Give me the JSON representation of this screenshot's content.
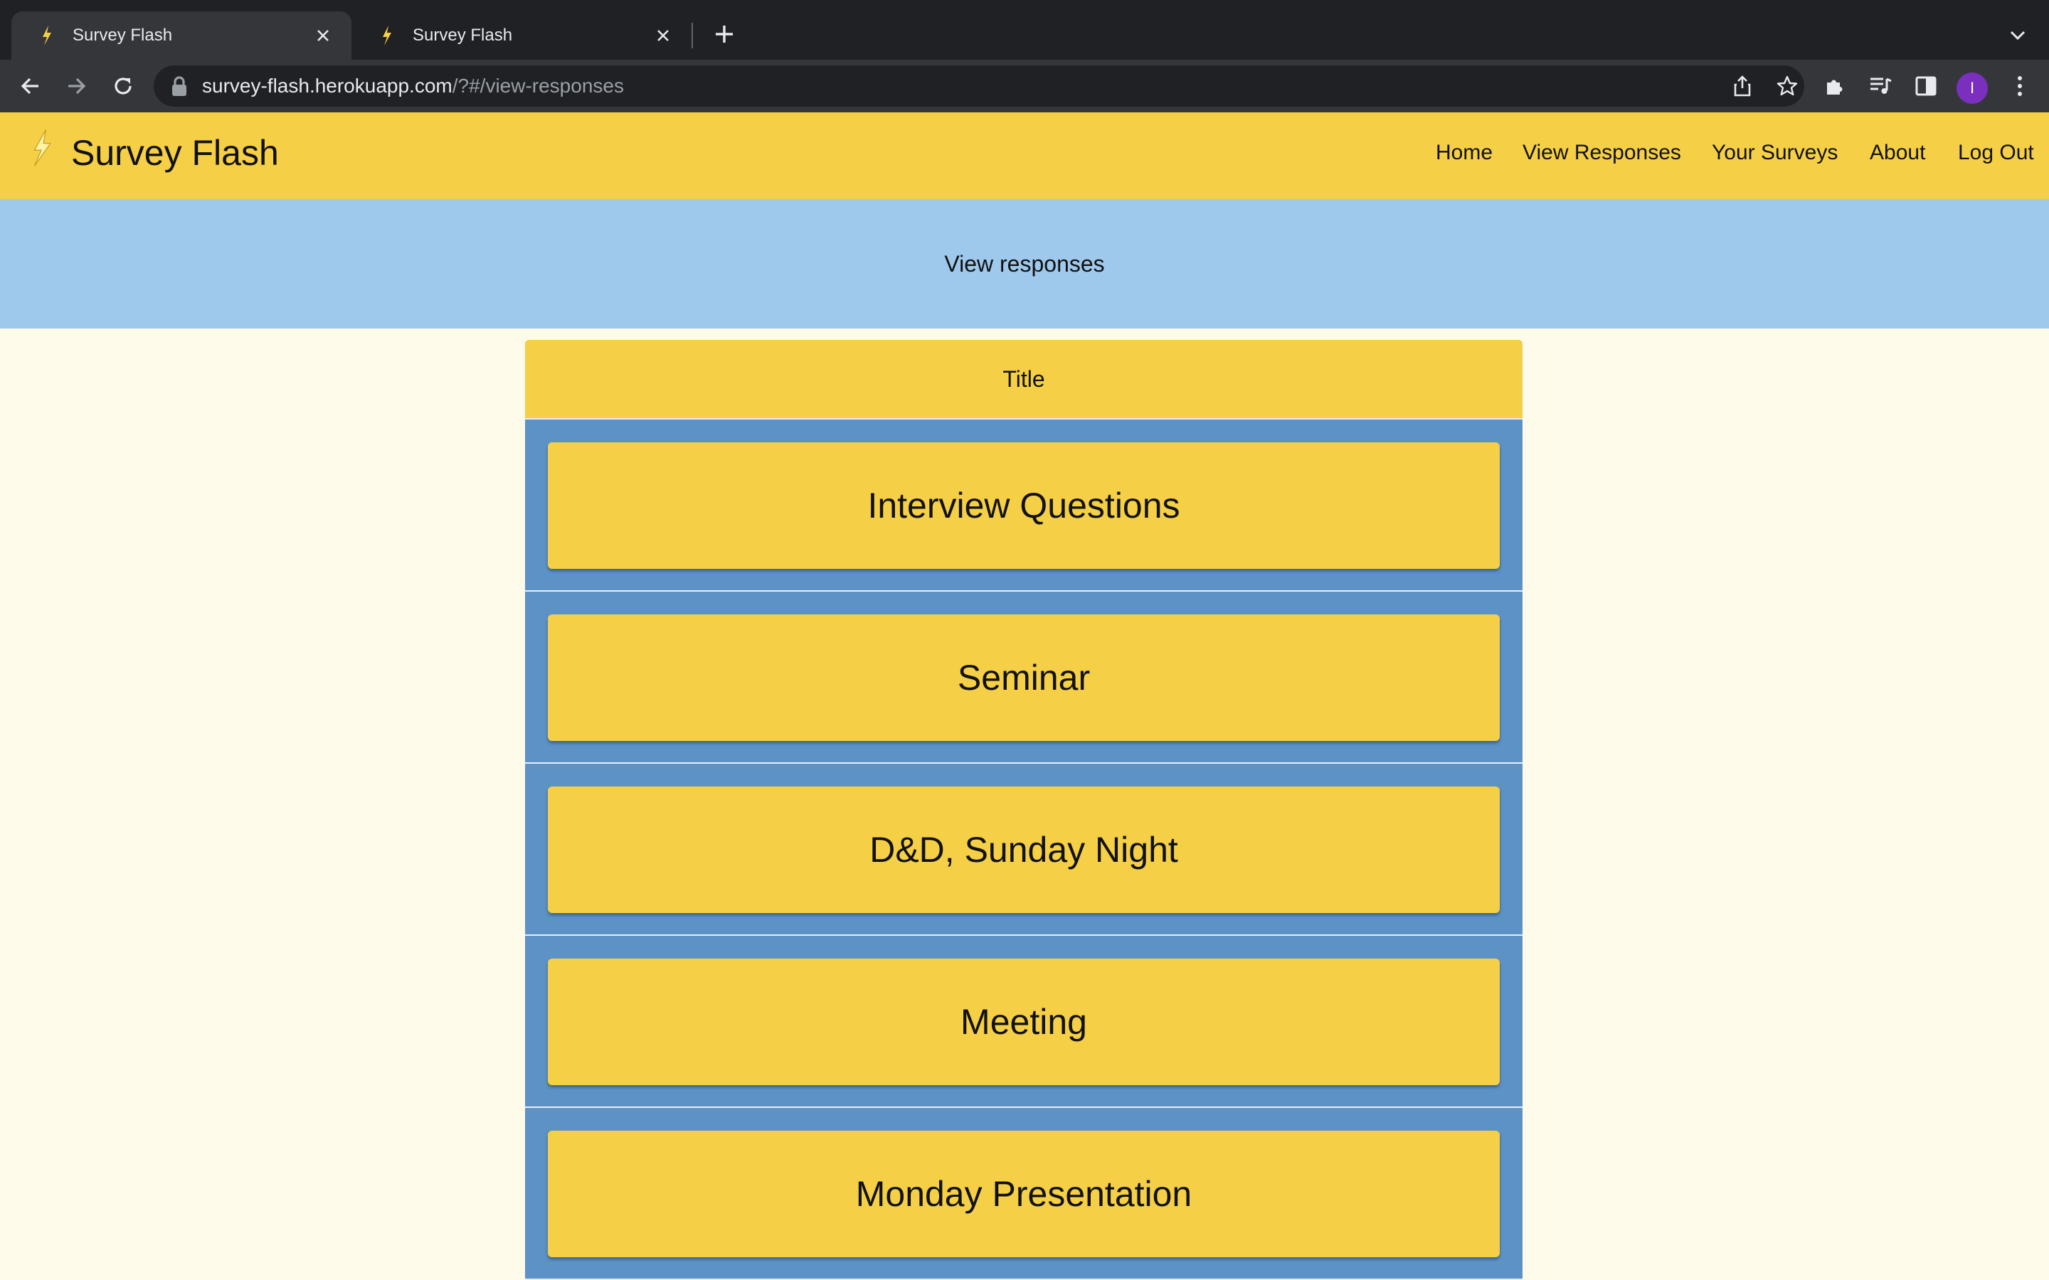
{
  "browser": {
    "tabs": [
      {
        "title": "Survey Flash",
        "active": true
      },
      {
        "title": "Survey Flash",
        "active": false
      }
    ],
    "url_host": "survey-flash.herokuapp.com",
    "url_path": "/?#/view-responses",
    "profile_initial": "I"
  },
  "site": {
    "brand": "Survey Flash",
    "nav": [
      "Home",
      "View Responses",
      "Your Surveys",
      "About",
      "Log Out"
    ]
  },
  "banner": {
    "text": "View responses"
  },
  "panel": {
    "header": "Title",
    "surveys": [
      "Interview Questions",
      "Seminar",
      "D&D, Sunday Night",
      "Meeting",
      "Monday Presentation"
    ]
  },
  "colors": {
    "header_yellow": "#f5cf45",
    "banner_blue": "#9ec9ed",
    "panel_blue": "#5d92c7",
    "page_background": "#fffbea"
  }
}
